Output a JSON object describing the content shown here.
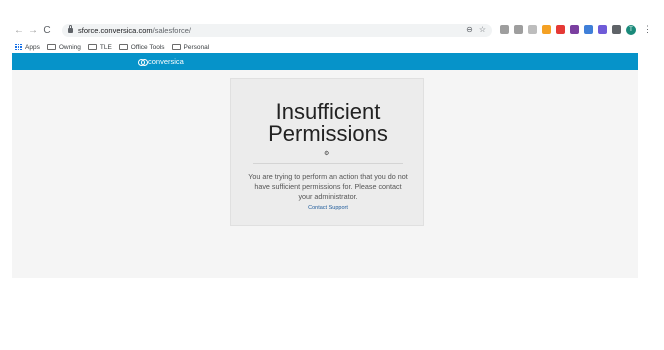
{
  "browser": {
    "url_host": "sforce.conversica.com",
    "url_path": "/salesforce/",
    "avatar_initial": "T",
    "nav": {
      "back": "←",
      "forward": "→",
      "reload": "C"
    },
    "omnibox_icons": {
      "zoom": "⊖",
      "star": "☆"
    },
    "menu": "⋮",
    "extensions": [
      {
        "name": "ext-1",
        "color": "#9e9e9e"
      },
      {
        "name": "ext-2",
        "color": "#9e9e9e"
      },
      {
        "name": "ext-3",
        "color": "#bdbdbd"
      },
      {
        "name": "ext-4",
        "color": "#f4a124"
      },
      {
        "name": "ext-5",
        "color": "#e53935"
      },
      {
        "name": "ext-6",
        "color": "#7b3fa0"
      },
      {
        "name": "ext-7",
        "color": "#3f7fd8"
      },
      {
        "name": "ext-8",
        "color": "#6f5bd8"
      },
      {
        "name": "ext-9",
        "color": "#5f6368"
      }
    ]
  },
  "bookmarks": {
    "apps": "Apps",
    "items": [
      "Owning",
      "TLE",
      "Office Tools",
      "Personal"
    ]
  },
  "page": {
    "brand": "conversica",
    "colors": {
      "header": "#0693c9",
      "background": "#f5f5f5",
      "card": "#ececec",
      "link": "#1d5a9a"
    },
    "card": {
      "title_line1": "Insufficient",
      "title_line2": "Permissions",
      "icon": "⚙",
      "message": "You are trying to perform an action that you do not have sufficient permissions for. Please contact your administrator.",
      "link": "Contact Support"
    }
  }
}
